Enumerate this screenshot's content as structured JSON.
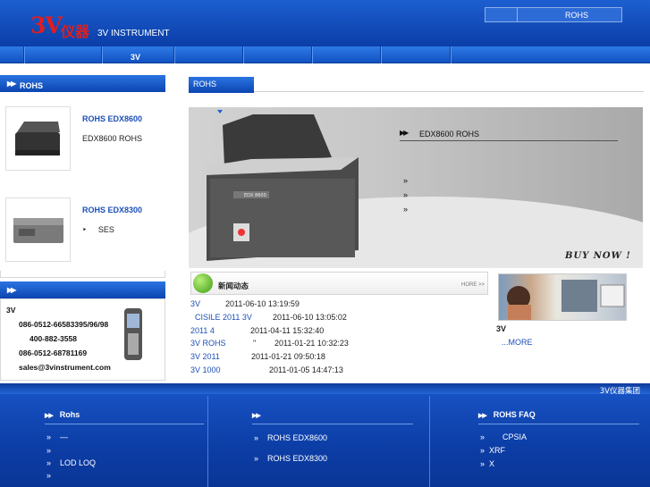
{
  "header": {
    "logo_3v": "3V",
    "logo_cn": "仪器",
    "logo_en": "3V INSTRUMENT",
    "top_link": "ROHS"
  },
  "nav": {
    "item_3v": "3V"
  },
  "sidebar": {
    "products_heading": "ROHS",
    "products": [
      {
        "title": "ROHS      EDX8600",
        "desc": "EDX8600      ROHS"
      },
      {
        "title": "ROHS      EDX8300",
        "desc": "SES"
      }
    ],
    "contact_heading": "",
    "contact": {
      "company": "3V",
      "phone1": "086-0512-66583395/96/98",
      "phone2": "400-882-3558",
      "phone3": "086-0512-68781169",
      "email": "sales@3vinstrument.com"
    }
  },
  "center": {
    "tab": "ROHS",
    "banner": {
      "title": "EDX8600       ROHS",
      "bullets": [
        "»",
        "»",
        "»"
      ],
      "buy_now": "BUY NOW !",
      "machine_label": "EDX 8600"
    },
    "news": {
      "title": "新闻动态",
      "more": "HORE >>",
      "items": [
        {
          "text": "3V",
          "date": "2011-06-10 13:19:59"
        },
        {
          "text": "CISILE 2011    3V",
          "date": "2011-06-10 13:05:02"
        },
        {
          "text": "2011 4",
          "date": "2011-04-11 15:32:40"
        },
        {
          "text": "3V  ROHS",
          "mid": "\"",
          "date": "2011-01-21 10:32:23"
        },
        {
          "text": "3V  2011",
          "date": "2011-01-21 09:50:18"
        },
        {
          "text": "3V      1000",
          "date": "2011-01-05 14:47:13"
        }
      ]
    }
  },
  "right": {
    "caption": "3V",
    "more": "...MORE"
  },
  "footer": {
    "brand": "3V仪器集团",
    "col1": {
      "heading": "Rohs",
      "items": [
        "—",
        "",
        "LOD       LOQ",
        ""
      ]
    },
    "col2": {
      "heading": "",
      "items": [
        "ROHS   EDX8600",
        "ROHS   EDX8300"
      ]
    },
    "col3": {
      "heading": "ROHS        FAQ",
      "items": [
        "CPSIA",
        "XRF",
        "X"
      ]
    }
  }
}
